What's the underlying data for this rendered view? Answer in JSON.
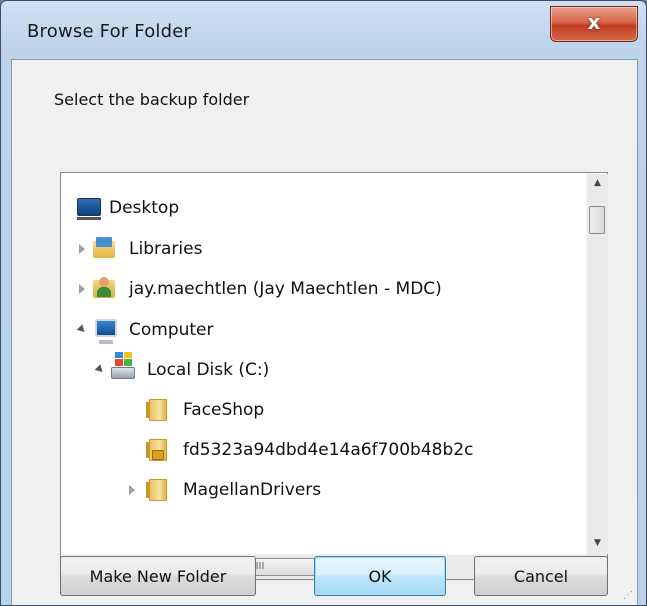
{
  "window": {
    "title": "Browse For Folder",
    "close_glyph": "x"
  },
  "prompt": "Select the backup folder",
  "tree": {
    "items": [
      {
        "label": "Desktop",
        "icon": "desktop-icon",
        "state": "none"
      },
      {
        "label": "Libraries",
        "icon": "libraries-icon",
        "state": "collapsed"
      },
      {
        "label": "jay.maechtlen (Jay Maechtlen - MDC)",
        "icon": "user-folder-icon",
        "state": "collapsed"
      },
      {
        "label": "Computer",
        "icon": "computer-icon",
        "state": "expanded"
      },
      {
        "label": "Local Disk (C:)",
        "icon": "local-disk-icon",
        "state": "expanded"
      },
      {
        "label": "FaceShop",
        "icon": "folder-icon",
        "state": "none"
      },
      {
        "label": "fd5323a94dbd4e14a6f700b48b2c",
        "icon": "locked-folder-icon",
        "state": "none"
      },
      {
        "label": "MagellanDrivers",
        "icon": "folder-icon",
        "state": "collapsed"
      }
    ]
  },
  "scrollbar": {
    "up": "▲",
    "down": "▼",
    "left": "◀",
    "right": "▶",
    "grip": "III"
  },
  "buttons": {
    "make_new_folder": "Make New Folder",
    "ok": "OK",
    "cancel": "Cancel"
  },
  "colors": {
    "title_bar": "#bcd3ea",
    "close_button": "#c94a2f",
    "dialog_bg": "#f0f0f0",
    "default_button": "#bee6fd"
  }
}
